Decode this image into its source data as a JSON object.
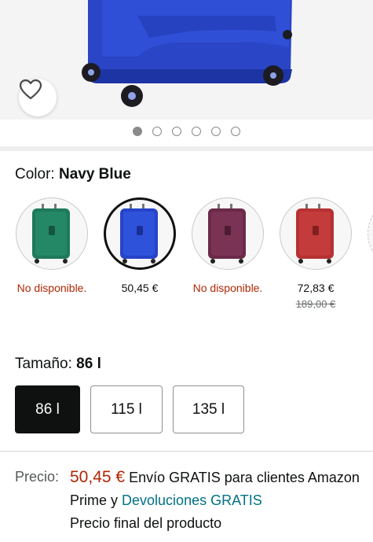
{
  "gallery": {
    "dots_total": 6,
    "dots_active_index": 0
  },
  "color": {
    "label": "Color:",
    "selected_value": "Navy Blue",
    "options": [
      {
        "name": "green",
        "hex": "#1f7a5a",
        "price": "No disponible.",
        "unavailable": true
      },
      {
        "name": "navy",
        "hex": "#2644c9",
        "price": "50,45 €",
        "unavailable": false,
        "selected": true
      },
      {
        "name": "purple",
        "hex": "#6b2a48",
        "price": "No disponible.",
        "unavailable": true
      },
      {
        "name": "red",
        "hex": "#b63232",
        "price": "72,83 €",
        "old_price": "189,00 €",
        "unavailable": false
      }
    ]
  },
  "size": {
    "label": "Tamaño:",
    "selected_value": "86 l",
    "options": [
      {
        "label": "86 l",
        "selected": true
      },
      {
        "label": "115 l",
        "selected": false
      },
      {
        "label": "135 l",
        "selected": false
      }
    ]
  },
  "price": {
    "label": "Precio:",
    "amount": "50,45 €",
    "shipping_text": "Envío GRATIS para clientes Amazon Prime y",
    "returns_link": "Devoluciones GRATIS",
    "final_note": "Precio final del producto"
  },
  "colors": {
    "accent_price": "#b12704",
    "link": "#007185",
    "selected_button": "#0f1111"
  },
  "icons": {
    "favorite": "heart-outline-icon"
  }
}
